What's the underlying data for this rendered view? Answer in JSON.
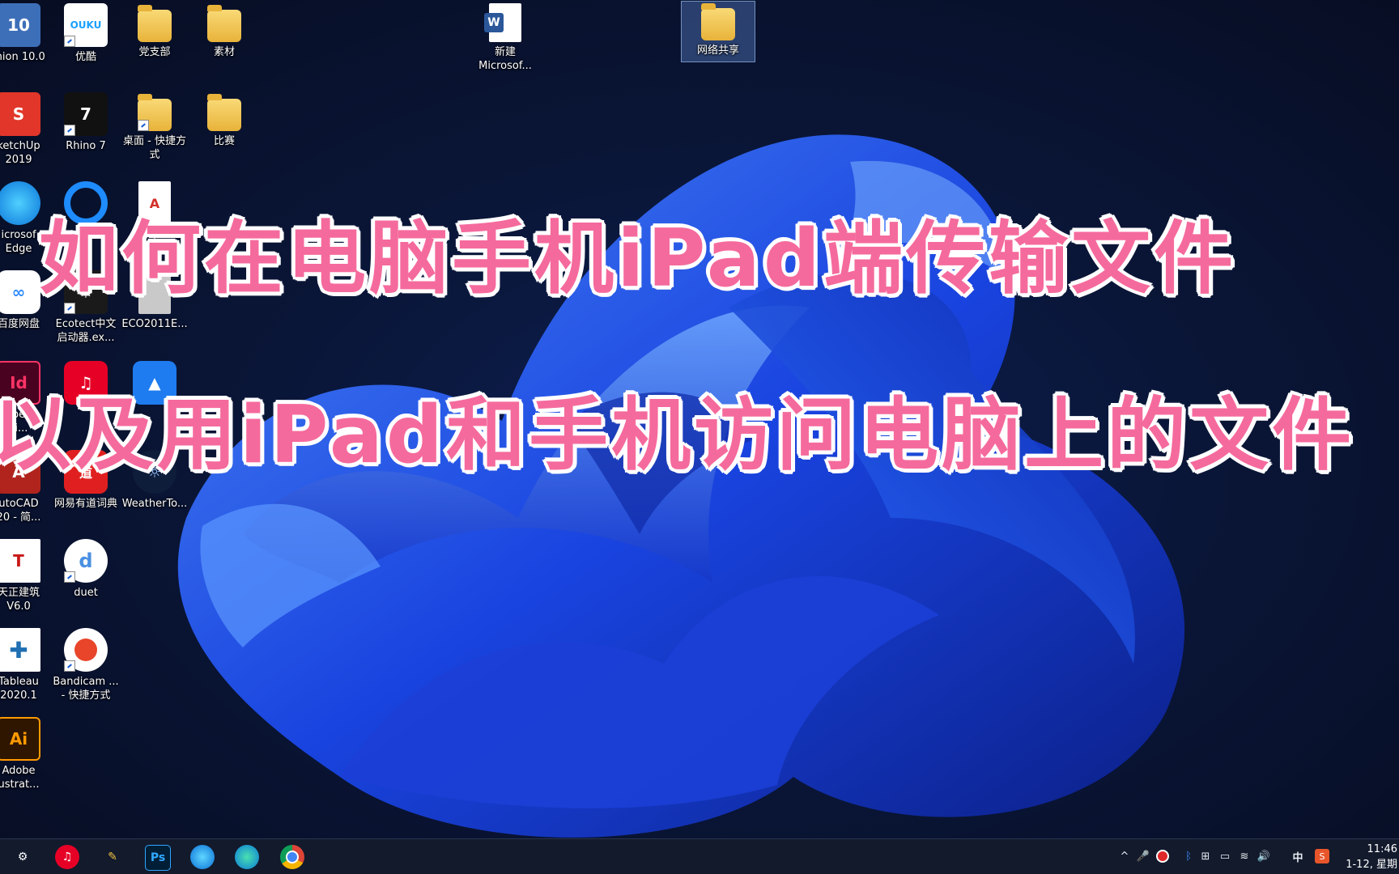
{
  "desktop": {
    "icons": [
      {
        "label": "mion 10.0",
        "icon": "app-tile-10"
      },
      {
        "label": "优酷",
        "icon": "youku-icon"
      },
      {
        "label": "党支部",
        "icon": "folder-icon"
      },
      {
        "label": "素材",
        "icon": "folder-icon"
      },
      {
        "label": "新建\nMicrosof...",
        "icon": "word-document-icon"
      },
      {
        "label": "网络共享",
        "icon": "folder-icon"
      },
      {
        "label": "ketchUp\n2019",
        "icon": "sketchup-icon"
      },
      {
        "label": "Rhino 7",
        "icon": "rhino-icon"
      },
      {
        "label": "桌面 - 快捷方\n式",
        "icon": "folder-shortcut-icon"
      },
      {
        "label": "比赛",
        "icon": "folder-icon"
      },
      {
        "label": "icrosof\nEdge",
        "icon": "edge-icon"
      },
      {
        "label": "",
        "icon": "app-icon"
      },
      {
        "label": "个",
        "icon": "pdf-icon"
      },
      {
        "label": "百度网盘",
        "icon": "baidu-netdisk-icon"
      },
      {
        "label": "Ecotect中文\n启动器.ex...",
        "icon": "ecotect-icon"
      },
      {
        "label": "ECO2011E...",
        "icon": "file-icon"
      },
      {
        "label": "be\nsi...",
        "icon": "indesign-icon"
      },
      {
        "label": "",
        "icon": "netease-music-icon"
      },
      {
        "label": "",
        "icon": "app-icon"
      },
      {
        "label": "utoCAD\n20 - 简...",
        "icon": "autocad-icon"
      },
      {
        "label": "网易有道词典",
        "icon": "youdao-icon"
      },
      {
        "label": "WeatherTo...",
        "icon": "weathertool-icon"
      },
      {
        "label": "天正建筑\nV6.0",
        "icon": "tangent-icon"
      },
      {
        "label": "duet",
        "icon": "duet-icon"
      },
      {
        "label": "Tableau\n2020.1",
        "icon": "tableau-icon"
      },
      {
        "label": "Bandicam ...\n- 快捷方式",
        "icon": "bandicam-icon"
      },
      {
        "label": "Adobe\nustrat...",
        "icon": "illustrator-icon"
      }
    ]
  },
  "overlay": {
    "line1": "如何在电脑手机iPad端传输文件",
    "line2": "以及用iPad和手机访问电脑上的文件"
  },
  "taskbar": {
    "apps": [
      "settings-icon",
      "netease-music-icon",
      "explorer-icon",
      "photoshop-icon",
      "edge-icon",
      "edge-icon",
      "chrome-icon"
    ],
    "ps_label": "Ps",
    "tray": {
      "ime": "中",
      "time": "11:46",
      "date": "1-12, 星期"
    }
  },
  "colors": {
    "overlay_text": "#f56a9c",
    "taskbar_bg": "#121a2c"
  }
}
